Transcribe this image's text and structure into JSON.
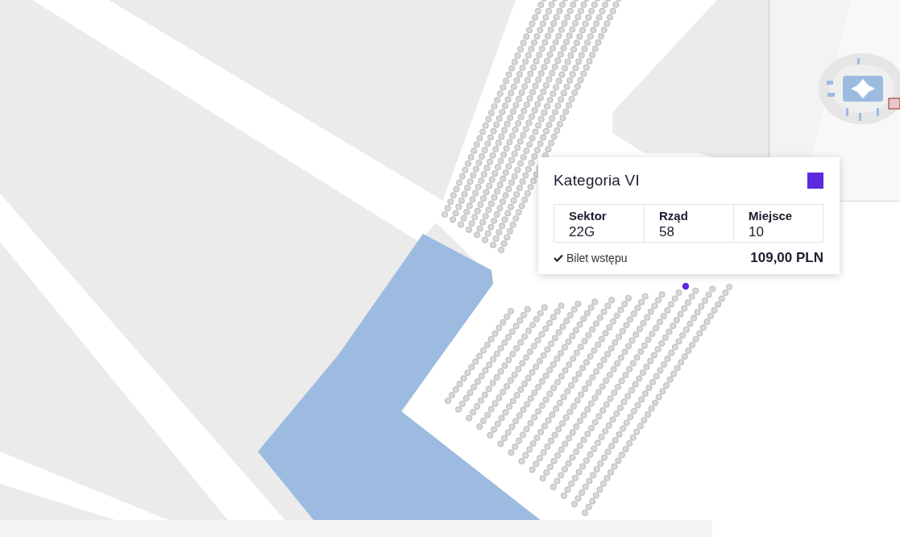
{
  "tooltip": {
    "title": "Kategoria VI",
    "color": "#5b2be0",
    "fields": [
      {
        "label": "Sektor",
        "value": "22G"
      },
      {
        "label": "Rząd",
        "value": "58"
      },
      {
        "label": "Miejsce",
        "value": "10"
      }
    ],
    "ticket": {
      "label": "Bilet wstępu",
      "included": true
    },
    "price": "109,00 PLN"
  }
}
